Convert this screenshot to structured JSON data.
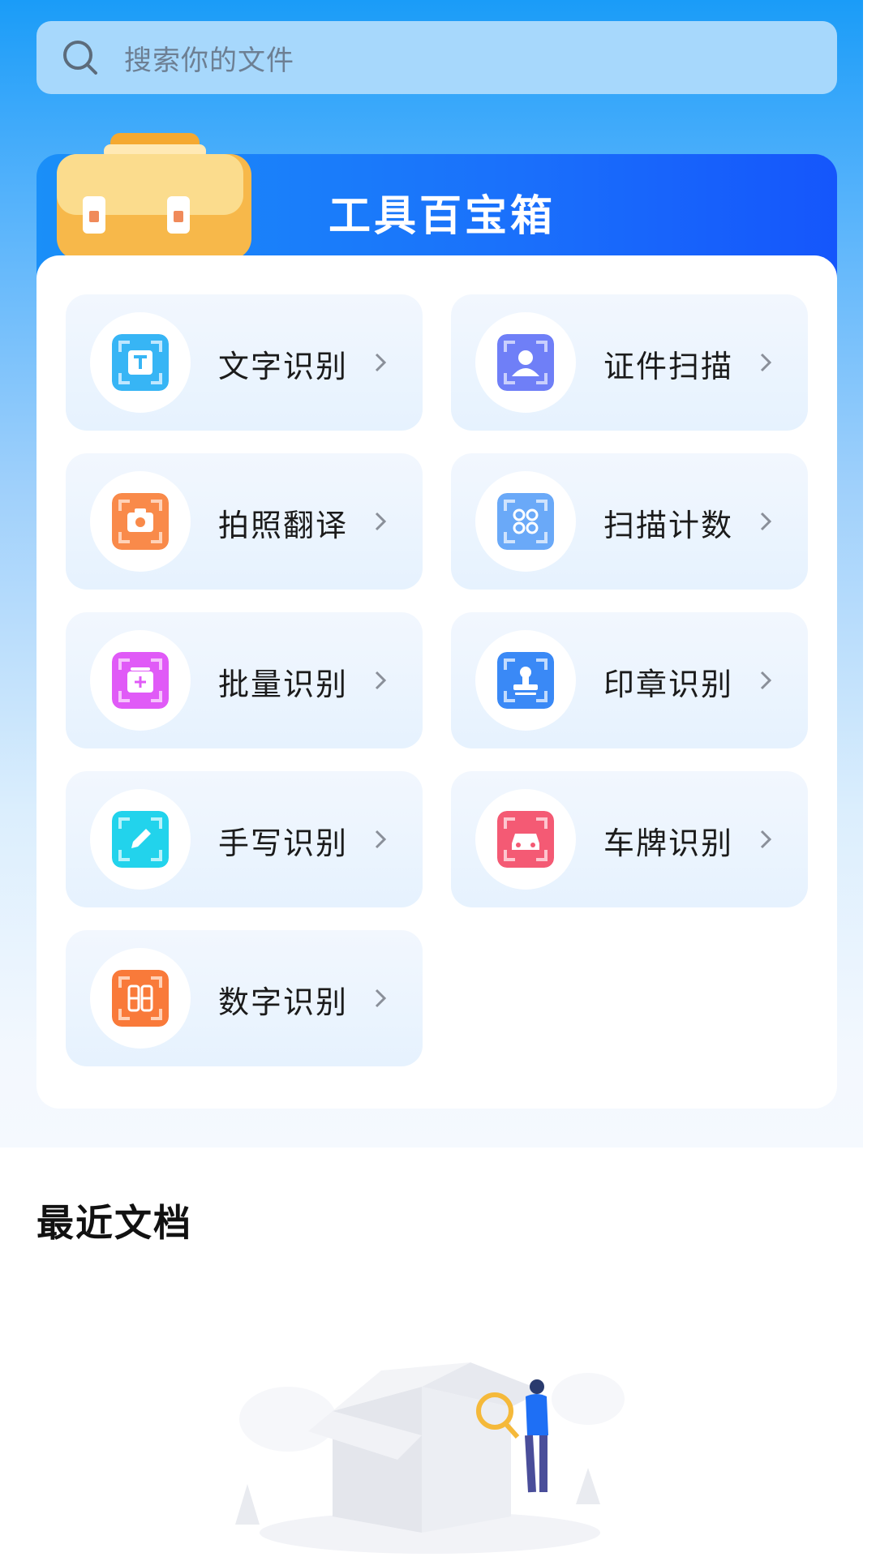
{
  "search": {
    "placeholder": "搜索你的文件",
    "icon": "search-icon"
  },
  "toolbox": {
    "title": "工具百宝箱",
    "tools": [
      {
        "label": "文字识别",
        "icon": "text-recognition-icon",
        "color": "#37b5f5"
      },
      {
        "label": "证件扫描",
        "icon": "id-scan-icon",
        "color": "#6f7ff7"
      },
      {
        "label": "拍照翻译",
        "icon": "camera-translate-icon",
        "color": "#f98a4a"
      },
      {
        "label": "扫描计数",
        "icon": "scan-count-icon",
        "color": "#6aa9f8"
      },
      {
        "label": "批量识别",
        "icon": "batch-recognition-icon",
        "color": "#e05af7"
      },
      {
        "label": "印章识别",
        "icon": "stamp-recognition-icon",
        "color": "#3a89f6"
      },
      {
        "label": "手写识别",
        "icon": "handwriting-icon",
        "color": "#22d3ec"
      },
      {
        "label": "车牌识别",
        "icon": "license-plate-icon",
        "color": "#f45a74"
      },
      {
        "label": "数字识别",
        "icon": "digit-recognition-icon",
        "color": "#f97a3a"
      }
    ]
  },
  "recent": {
    "title": "最近文档"
  },
  "colors": {
    "accent": "#1a70fb",
    "background_top": "#1a9cf8"
  }
}
